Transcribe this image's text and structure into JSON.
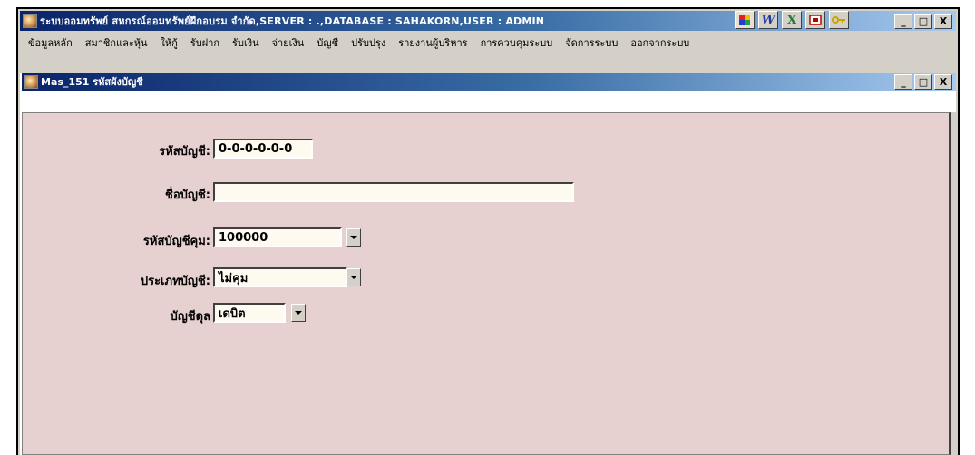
{
  "app": {
    "title": "ระบบออมทรัพย์ สหกรณ์ออมทรัพย์ฝึกอบรม จำกัด,SERVER : .,DATABASE : SAHAKORN,USER : ADMIN",
    "toolbar_icons": [
      "logo-icon",
      "word-icon",
      "excel-icon",
      "powerpoint-icon",
      "key-icon"
    ],
    "window_buttons": {
      "minimize": "_",
      "maximize": "□",
      "close": "X"
    }
  },
  "menu": [
    "ข้อมูลหลัก",
    "สมาชิกและหุ้น",
    "ให้กู้",
    "รับฝาก",
    "รับเงิน",
    "จ่ายเงิน",
    "บัญชี",
    "ปรับปรุง",
    "รายงานผู้บริหาร",
    "การควบคุมระบบ",
    "จัดการระบบ",
    "ออกจากระบบ"
  ],
  "child_window": {
    "title": "Mas_151 รหัสผังบัญชี",
    "window_buttons": {
      "minimize": "_",
      "maximize": "□",
      "close": "X"
    }
  },
  "form": {
    "account_code": {
      "label": "รหัสบัญชี:",
      "value": "0-0-0-0-0-0"
    },
    "account_name": {
      "label": "ชื่อบัญชี:",
      "value": ""
    },
    "control_account": {
      "label": "รหัสบัญชีคุม:",
      "value": "100000"
    },
    "account_type": {
      "label": "ประเภทบัญชี:",
      "value": "ไม่คุม"
    },
    "balance_side": {
      "label": "บัญชีดุล",
      "value": "เดบิต"
    }
  },
  "colors": {
    "titlebar_start": "#0a246a",
    "titlebar_end": "#a6caf0",
    "form_background": "#e6d0d0",
    "field_background": "#fffaef"
  }
}
